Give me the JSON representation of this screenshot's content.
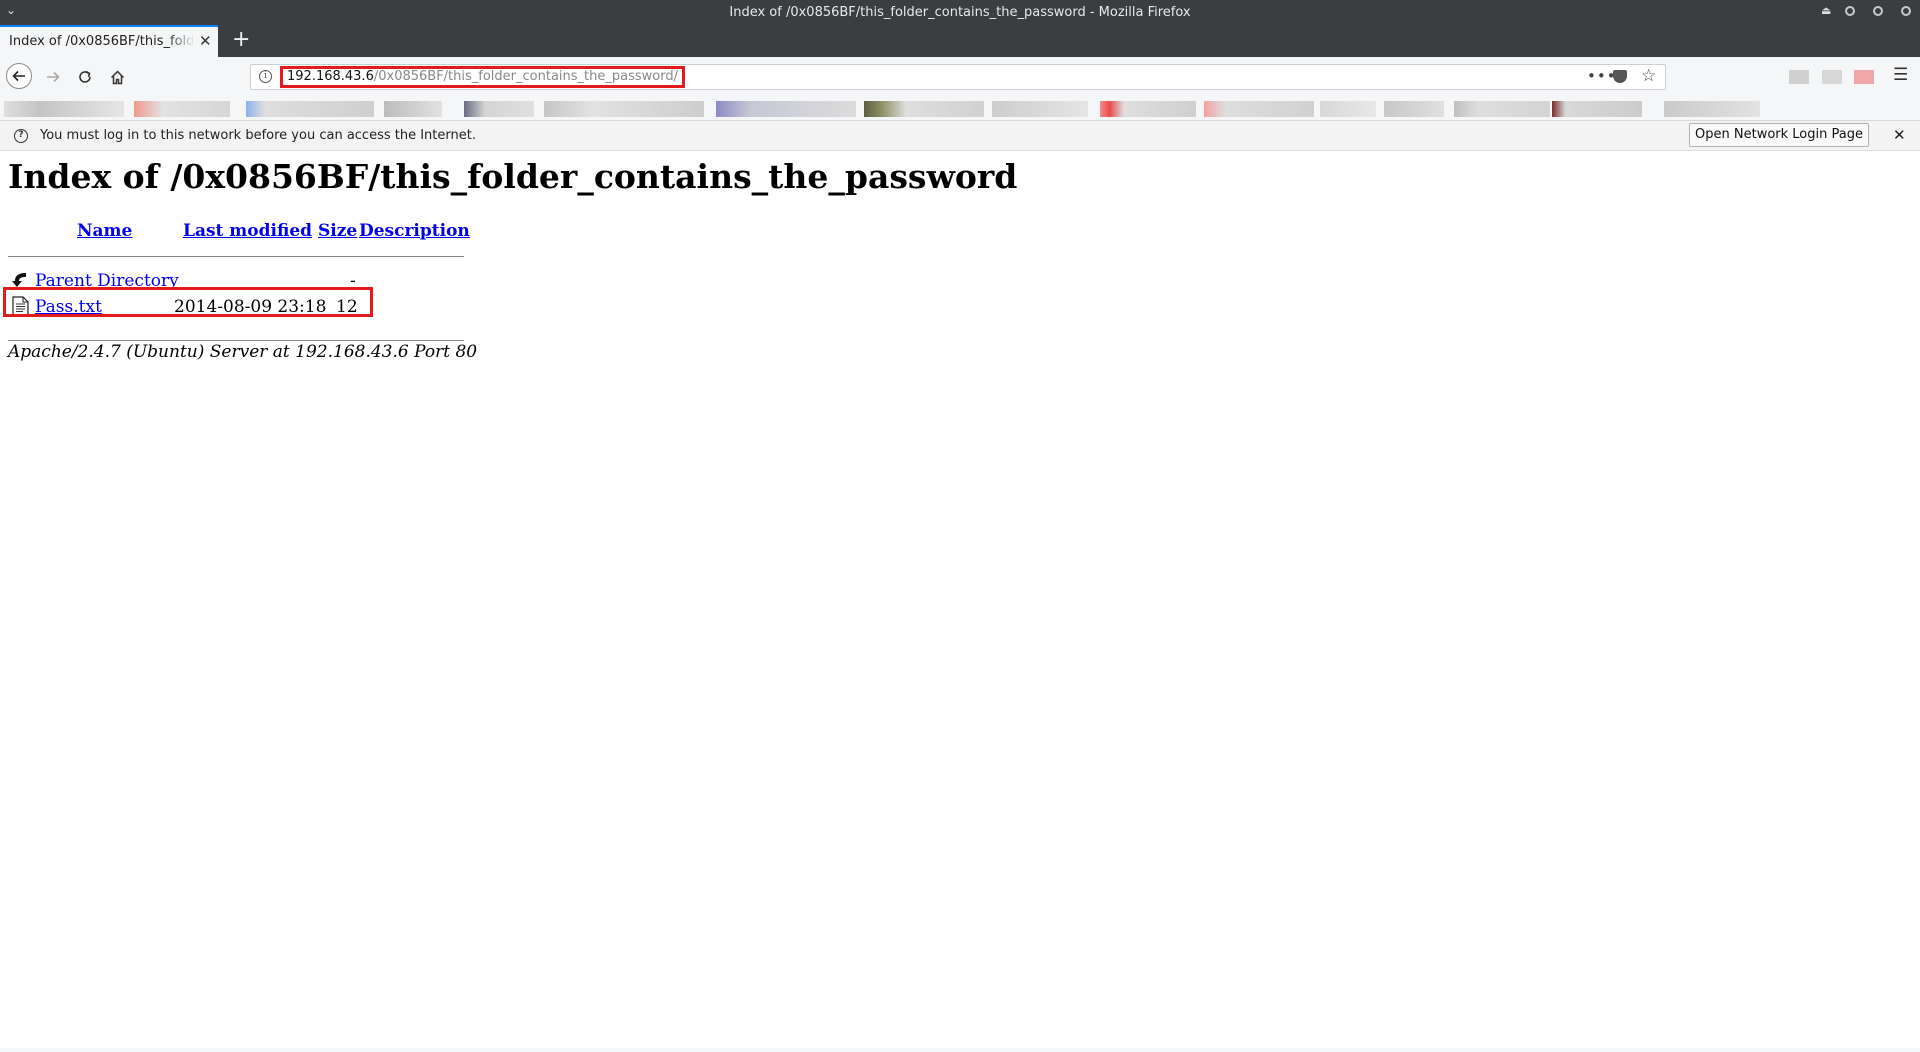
{
  "window": {
    "title": "Index of /0x0856BF/this_folder_contains_the_password - Mozilla Firefox"
  },
  "tabs": [
    {
      "label": "Index of /0x0856BF/this_folder_contains_the_password",
      "active": true
    }
  ],
  "urlbar": {
    "host": "192.168.43.6",
    "path": "/0x0856BF/this_folder_contains_the_password/"
  },
  "notification": {
    "text": "You must log in to this network before you can access the Internet.",
    "button_label": "Open Network Login Page"
  },
  "page": {
    "heading": "Index of /0x0856BF/this_folder_contains_the_password",
    "columns": {
      "name": "Name",
      "last_modified": "Last modified",
      "size": "Size",
      "description": "Description"
    },
    "rows": [
      {
        "name": "Parent Directory",
        "last_modified": "",
        "size": "-",
        "description": "",
        "icon": "back-arrow-icon"
      },
      {
        "name": "Pass.txt",
        "last_modified": "2014-08-09 23:18",
        "size": "12",
        "description": "",
        "icon": "text-file-icon"
      }
    ],
    "server_signature": "Apache/2.4.7 (Ubuntu) Server at 192.168.43.6 Port 80"
  },
  "colors": {
    "highlight": "#e31b1b",
    "link": "#0000ee",
    "chrome_dark": "#3b3e41",
    "chrome_light": "#f5f6f7"
  }
}
